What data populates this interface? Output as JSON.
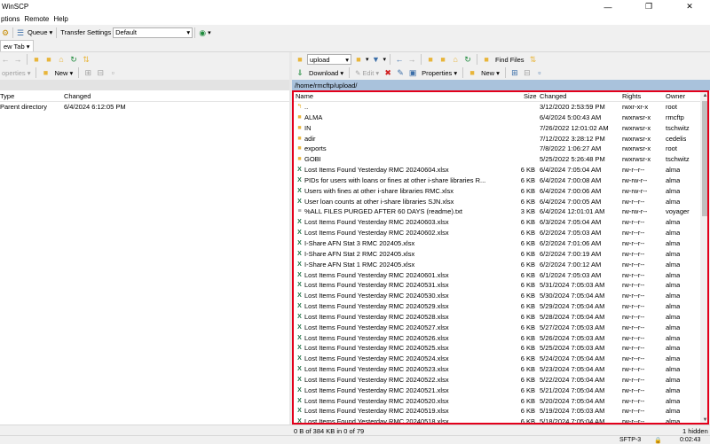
{
  "window": {
    "title": "WinSCP"
  },
  "menu": [
    "ptions",
    "Remote",
    "Help"
  ],
  "toolbar": {
    "queue": "Queue",
    "transfer_label": "Transfer Settings",
    "transfer_value": "Default"
  },
  "tabs": {
    "new_tab": "ew Tab"
  },
  "left_toolbar": {
    "properties": "operties",
    "new": "New"
  },
  "left_panel": {
    "headers": {
      "type": "Type",
      "changed": "Changed"
    },
    "rows": [
      {
        "type": "Parent directory",
        "changed": "6/4/2024 6:12:05 PM"
      }
    ]
  },
  "right_toolbar": {
    "folder": "upload",
    "find_files": "Find Files",
    "download": "Download",
    "edit": "Edit",
    "properties": "Properties",
    "new": "New"
  },
  "path": "/home/rmcftp/upload/",
  "right_panel": {
    "headers": {
      "name": "Name",
      "size": "Size",
      "changed": "Changed",
      "rights": "Rights",
      "owner": "Owner"
    },
    "rows": [
      {
        "icon": "parent",
        "name": "..",
        "size": "",
        "changed": "3/12/2020 2:53:59 PM",
        "rights": "rwxr-xr-x",
        "owner": "root"
      },
      {
        "icon": "folder",
        "name": "ALMA",
        "size": "",
        "changed": "6/4/2024 5:00:43 AM",
        "rights": "rwxrwsr-x",
        "owner": "rmcftp"
      },
      {
        "icon": "folder",
        "name": "IN",
        "size": "",
        "changed": "7/26/2022 12:01:02 AM",
        "rights": "rwxrwsr-x",
        "owner": "tschwitz"
      },
      {
        "icon": "folder",
        "name": "adir",
        "size": "",
        "changed": "7/12/2022 3:28:12 PM",
        "rights": "rwxrwsr-x",
        "owner": "cedelis"
      },
      {
        "icon": "folder",
        "name": "exports",
        "size": "",
        "changed": "7/8/2022 1:06:27 AM",
        "rights": "rwxrwsr-x",
        "owner": "root"
      },
      {
        "icon": "folder",
        "name": "GOBI",
        "size": "",
        "changed": "5/25/2022 5:26:48 PM",
        "rights": "rwxrwsr-x",
        "owner": "tschwitz"
      },
      {
        "icon": "xlsx",
        "name": "Lost Items Found Yesterday RMC 20240604.xlsx",
        "size": "6 KB",
        "changed": "6/4/2024 7:05:04 AM",
        "rights": "rw-r--r--",
        "owner": "alma"
      },
      {
        "icon": "xlsx",
        "name": "PIDs for users with loans or fines at other i-share libraries R...",
        "size": "6 KB",
        "changed": "6/4/2024 7:00:08 AM",
        "rights": "rw-rw-r--",
        "owner": "alma"
      },
      {
        "icon": "xlsx",
        "name": "Users with fines at other i-share libraries RMC.xlsx",
        "size": "6 KB",
        "changed": "6/4/2024 7:00:06 AM",
        "rights": "rw-rw-r--",
        "owner": "alma"
      },
      {
        "icon": "xlsx",
        "name": "User loan counts at other i-share libraries SJN.xlsx",
        "size": "6 KB",
        "changed": "6/4/2024 7:00:05 AM",
        "rights": "rw-r--r--",
        "owner": "alma"
      },
      {
        "icon": "txt",
        "name": "%ALL FILES PURGED AFTER 60 DAYS (readme).txt",
        "size": "3 KB",
        "changed": "6/4/2024 12:01:01 AM",
        "rights": "rw-rw-r--",
        "owner": "voyager"
      },
      {
        "icon": "xlsx",
        "name": "Lost Items Found Yesterday RMC 20240603.xlsx",
        "size": "6 KB",
        "changed": "6/3/2024 7:05:04 AM",
        "rights": "rw-r--r--",
        "owner": "alma"
      },
      {
        "icon": "xlsx",
        "name": "Lost Items Found Yesterday RMC 20240602.xlsx",
        "size": "6 KB",
        "changed": "6/2/2024 7:05:03 AM",
        "rights": "rw-r--r--",
        "owner": "alma"
      },
      {
        "icon": "xlsx",
        "name": "I-Share AFN Stat 3 RMC 202405.xlsx",
        "size": "6 KB",
        "changed": "6/2/2024 7:01:06 AM",
        "rights": "rw-r--r--",
        "owner": "alma"
      },
      {
        "icon": "xlsx",
        "name": "I-Share AFN Stat 2 RMC 202405.xlsx",
        "size": "6 KB",
        "changed": "6/2/2024 7:00:19 AM",
        "rights": "rw-r--r--",
        "owner": "alma"
      },
      {
        "icon": "xlsx",
        "name": "I-Share AFN Stat 1 RMC 202405.xlsx",
        "size": "6 KB",
        "changed": "6/2/2024 7:00:12 AM",
        "rights": "rw-r--r--",
        "owner": "alma"
      },
      {
        "icon": "xlsx",
        "name": "Lost Items Found Yesterday RMC 20240601.xlsx",
        "size": "6 KB",
        "changed": "6/1/2024 7:05:03 AM",
        "rights": "rw-r--r--",
        "owner": "alma"
      },
      {
        "icon": "xlsx",
        "name": "Lost Items Found Yesterday RMC 20240531.xlsx",
        "size": "6 KB",
        "changed": "5/31/2024 7:05:03 AM",
        "rights": "rw-r--r--",
        "owner": "alma"
      },
      {
        "icon": "xlsx",
        "name": "Lost Items Found Yesterday RMC 20240530.xlsx",
        "size": "6 KB",
        "changed": "5/30/2024 7:05:04 AM",
        "rights": "rw-r--r--",
        "owner": "alma"
      },
      {
        "icon": "xlsx",
        "name": "Lost Items Found Yesterday RMC 20240529.xlsx",
        "size": "6 KB",
        "changed": "5/29/2024 7:05:04 AM",
        "rights": "rw-r--r--",
        "owner": "alma"
      },
      {
        "icon": "xlsx",
        "name": "Lost Items Found Yesterday RMC 20240528.xlsx",
        "size": "6 KB",
        "changed": "5/28/2024 7:05:04 AM",
        "rights": "rw-r--r--",
        "owner": "alma"
      },
      {
        "icon": "xlsx",
        "name": "Lost Items Found Yesterday RMC 20240527.xlsx",
        "size": "6 KB",
        "changed": "5/27/2024 7:05:03 AM",
        "rights": "rw-r--r--",
        "owner": "alma"
      },
      {
        "icon": "xlsx",
        "name": "Lost Items Found Yesterday RMC 20240526.xlsx",
        "size": "6 KB",
        "changed": "5/26/2024 7:05:03 AM",
        "rights": "rw-r--r--",
        "owner": "alma"
      },
      {
        "icon": "xlsx",
        "name": "Lost Items Found Yesterday RMC 20240525.xlsx",
        "size": "6 KB",
        "changed": "5/25/2024 7:05:03 AM",
        "rights": "rw-r--r--",
        "owner": "alma"
      },
      {
        "icon": "xlsx",
        "name": "Lost Items Found Yesterday RMC 20240524.xlsx",
        "size": "6 KB",
        "changed": "5/24/2024 7:05:04 AM",
        "rights": "rw-r--r--",
        "owner": "alma"
      },
      {
        "icon": "xlsx",
        "name": "Lost Items Found Yesterday RMC 20240523.xlsx",
        "size": "6 KB",
        "changed": "5/23/2024 7:05:04 AM",
        "rights": "rw-r--r--",
        "owner": "alma"
      },
      {
        "icon": "xlsx",
        "name": "Lost Items Found Yesterday RMC 20240522.xlsx",
        "size": "6 KB",
        "changed": "5/22/2024 7:05:04 AM",
        "rights": "rw-r--r--",
        "owner": "alma"
      },
      {
        "icon": "xlsx",
        "name": "Lost Items Found Yesterday RMC 20240521.xlsx",
        "size": "6 KB",
        "changed": "5/21/2024 7:05:04 AM",
        "rights": "rw-r--r--",
        "owner": "alma"
      },
      {
        "icon": "xlsx",
        "name": "Lost Items Found Yesterday RMC 20240520.xlsx",
        "size": "6 KB",
        "changed": "5/20/2024 7:05:04 AM",
        "rights": "rw-r--r--",
        "owner": "alma"
      },
      {
        "icon": "xlsx",
        "name": "Lost Items Found Yesterday RMC 20240519.xlsx",
        "size": "6 KB",
        "changed": "5/19/2024 7:05:03 AM",
        "rights": "rw-r--r--",
        "owner": "alma"
      },
      {
        "icon": "xlsx",
        "name": "Lost Items Found Yesterday RMC 20240518.xlsx",
        "size": "6 KB",
        "changed": "5/18/2024 7:05:04 AM",
        "rights": "rw-r--r--",
        "owner": "alma"
      }
    ]
  },
  "status": {
    "right": "0 B of 384 KB in 0 of 79",
    "hidden": "1 hidden",
    "protocol": "SFTP-3",
    "time": "0:02:43"
  },
  "colors": {
    "accent": "#a9c2dc",
    "highlight": "#e3001b",
    "folder": "#e8b53a",
    "excel": "#1e7145"
  }
}
